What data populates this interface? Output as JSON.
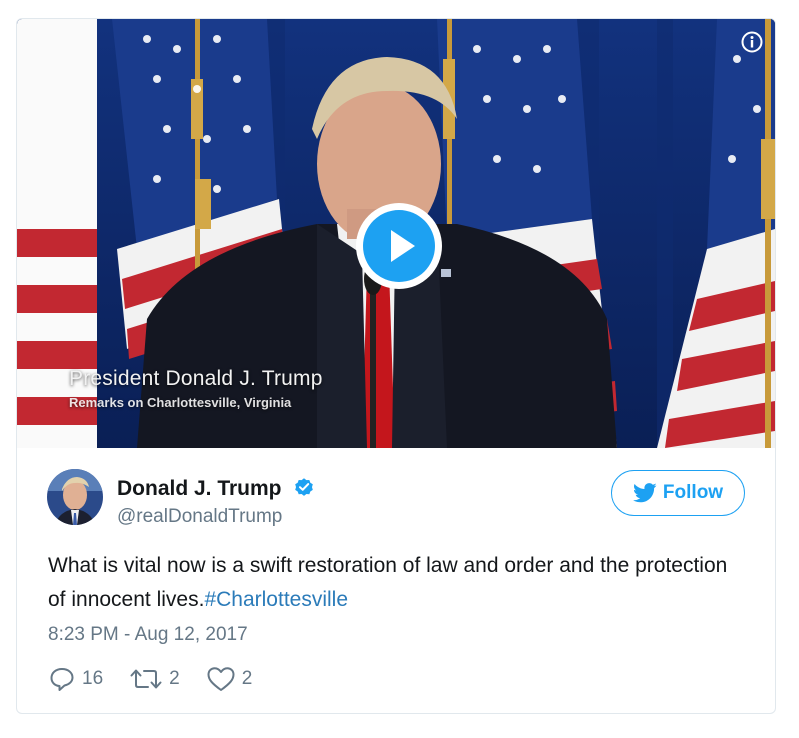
{
  "media": {
    "caption_title": "President Donald J. Trump",
    "caption_subtitle": "Remarks on Charlottesville, Virginia",
    "info_icon": "info-circle-icon",
    "play_icon": "play-button-icon"
  },
  "author": {
    "name": "Donald J. Trump",
    "handle": "@realDonaldTrump",
    "verified": true
  },
  "follow_button": {
    "label": "Follow"
  },
  "tweet": {
    "text": "What is vital now is a swift restoration of law and order and the protection of innocent lives.",
    "hashtag": "#Charlottesville",
    "timestamp": "8:23 PM - Aug 12, 2017"
  },
  "actions": {
    "replies": "16",
    "retweets": "2",
    "likes": "2"
  },
  "colors": {
    "accent": "#1da1f2",
    "hashtag": "#2b7bb9",
    "muted": "#657786",
    "text": "#14171a",
    "border": "#e1e8ed"
  }
}
